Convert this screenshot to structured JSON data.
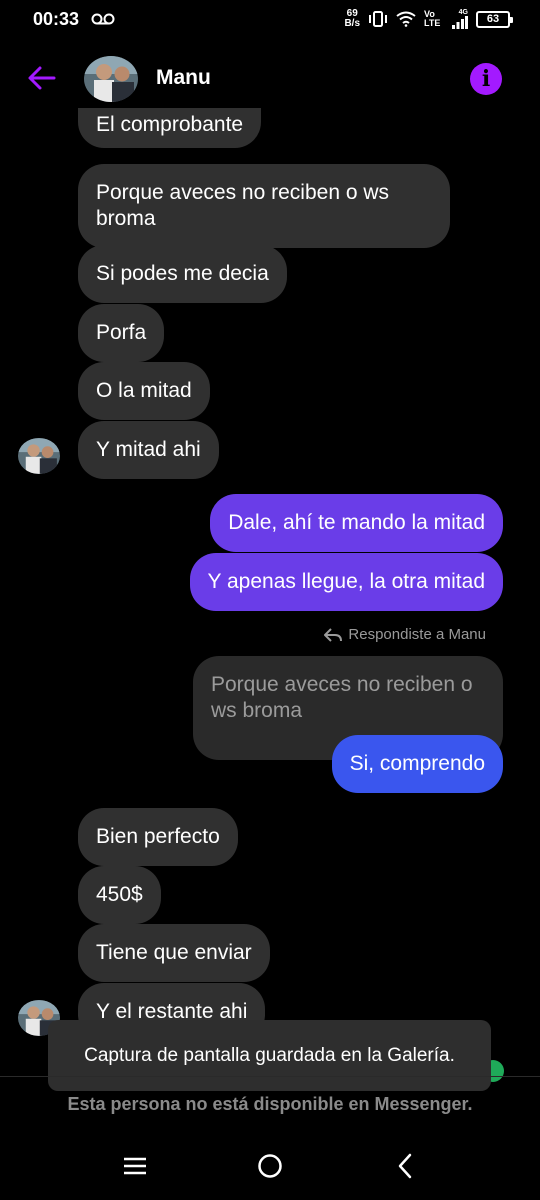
{
  "status_bar": {
    "time": "00:33",
    "speed_value": "69",
    "speed_unit": "B/s",
    "network": "Vo LTE",
    "network_type": "4G",
    "battery": "63"
  },
  "header": {
    "contact_name": "Manu",
    "accent_color": "#a31aff"
  },
  "messages": {
    "m1": "El comprobante",
    "m2": "Porque aveces no reciben o ws broma",
    "m3": "Si podes me decia",
    "m4": "Porfa",
    "m5": "O la mitad",
    "m6": "Y mitad ahi",
    "m7": "Dale, ahí te mando la mitad",
    "m8": "Y apenas llegue, la otra mitad",
    "reply_note": "Respondiste a Manu",
    "quoted": "Porque aveces no reciben o ws broma",
    "m9": "Si, comprendo",
    "m10": "Bien perfecto",
    "m11": "450$",
    "m12": "Tiene que enviar",
    "m13": "Y el restante ahi"
  },
  "toast": {
    "text": "Captura de pantalla guardada en la Galería."
  },
  "footer": {
    "unavailable_text": "Esta persona no está disponible en Messenger."
  },
  "icons": {
    "back": "back-arrow-icon",
    "info": "info-icon",
    "voicemail": "voicemail-icon",
    "reply": "reply-icon",
    "menu": "menu-icon",
    "home": "home-icon",
    "nav_back": "nav-back-icon"
  }
}
